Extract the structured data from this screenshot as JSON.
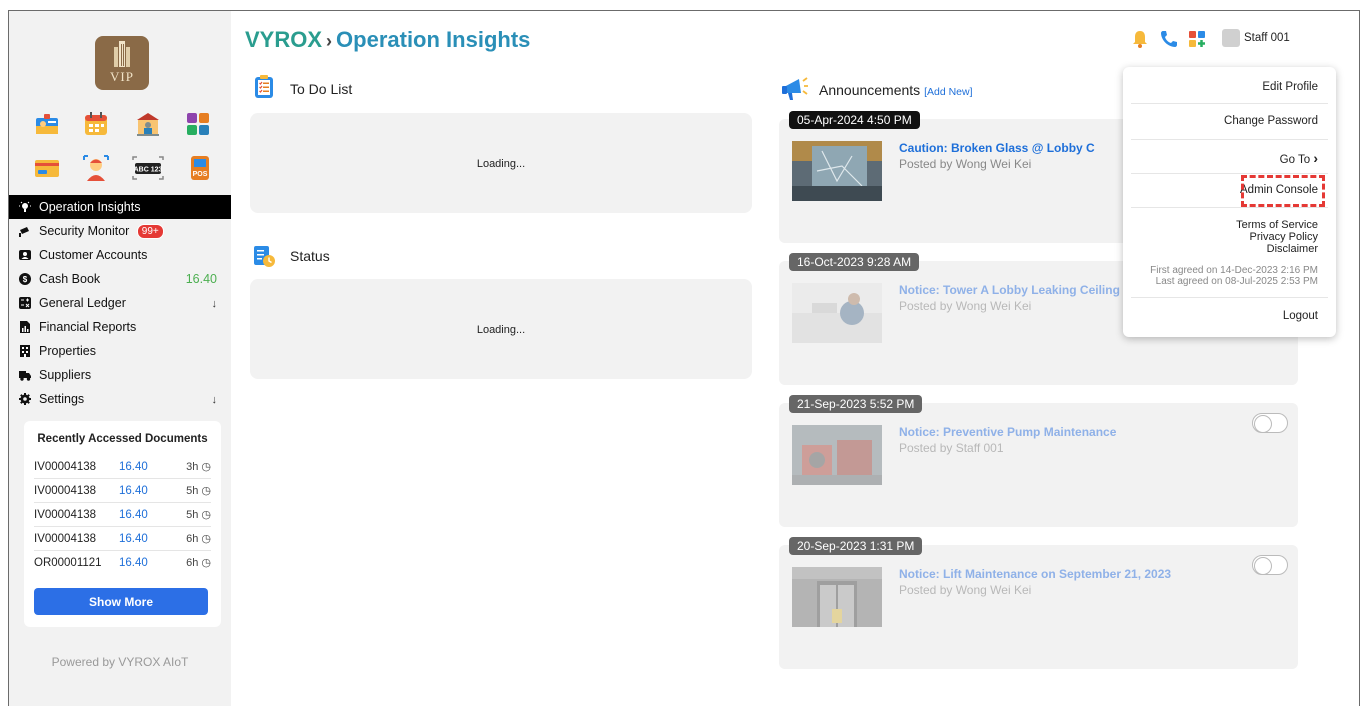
{
  "header": {
    "brand": "VYROX",
    "separator": "›",
    "page_title": "Operation Insights"
  },
  "logo": {
    "text": "VIP"
  },
  "apps": [
    {
      "icon": "id-card-icon"
    },
    {
      "icon": "calendar-icon"
    },
    {
      "icon": "bank-icon"
    },
    {
      "icon": "puzzle-icon"
    },
    {
      "icon": "credit-card-icon"
    },
    {
      "icon": "face-scan-icon"
    },
    {
      "icon": "license-plate-icon",
      "text": "ABC 123"
    },
    {
      "icon": "pos-icon",
      "text": "POS"
    }
  ],
  "sidebar": {
    "items": [
      {
        "label": "Operation Insights",
        "icon": "lightbulb-icon",
        "active": true
      },
      {
        "label": "Security Monitor",
        "icon": "cctv-icon",
        "badge": "99+"
      },
      {
        "label": "Customer Accounts",
        "icon": "address-card-icon"
      },
      {
        "label": "Cash Book",
        "icon": "dollar-circle-icon",
        "value": "16.40"
      },
      {
        "label": "General Ledger",
        "icon": "calculator-icon",
        "arrow": "↓"
      },
      {
        "label": "Financial Reports",
        "icon": "report-icon"
      },
      {
        "label": "Properties",
        "icon": "building-icon"
      },
      {
        "label": "Suppliers",
        "icon": "truck-icon"
      },
      {
        "label": "Settings",
        "icon": "gear-icon",
        "arrow": "↓"
      }
    ]
  },
  "recent": {
    "title": "Recently Accessed Documents",
    "rows": [
      {
        "doc": "IV00004138",
        "amount": "16.40",
        "ago": "3h"
      },
      {
        "doc": "IV00004138",
        "amount": "16.40",
        "ago": "5h"
      },
      {
        "doc": "IV00004138",
        "amount": "16.40",
        "ago": "5h"
      },
      {
        "doc": "IV00004138",
        "amount": "16.40",
        "ago": "6h"
      },
      {
        "doc": "OR00001121",
        "amount": "16.40",
        "ago": "6h"
      }
    ],
    "show_more": "Show More"
  },
  "footer": {
    "powered_by": "Powered by VYROX AIoT"
  },
  "todo": {
    "title": "To Do List",
    "loading": "Loading..."
  },
  "status": {
    "title": "Status",
    "loading": "Loading..."
  },
  "announcements": {
    "title": "Announcements",
    "add_new": "[Add New]",
    "items": [
      {
        "date": "05-Apr-2024 4:50 PM",
        "title": "Caution: Broken Glass @ Lobby C",
        "by": "Posted by Wong Wei Kei"
      },
      {
        "date": "16-Oct-2023 9:28 AM",
        "title": "Notice: Tower A Lobby Leaking Ceiling Re",
        "by": "Posted by Wong Wei Kei"
      },
      {
        "date": "21-Sep-2023 5:52 PM",
        "title": "Notice: Preventive Pump Maintenance",
        "by": "Posted by Staff 001"
      },
      {
        "date": "20-Sep-2023 1:31 PM",
        "title": "Notice: Lift Maintenance on September 21, 2023",
        "by": "Posted by Wong Wei Kei"
      }
    ]
  },
  "user": {
    "name": "Staff 001"
  },
  "dropdown": {
    "edit_profile": "Edit Profile",
    "change_password": "Change Password",
    "go_to": "Go To",
    "go_to_arrow": "›",
    "admin_console": "Admin Console",
    "terms": "Terms of Service",
    "privacy": "Privacy Policy",
    "disclaimer": "Disclaimer",
    "first_agreed": "First agreed on 14-Dec-2023 2:16 PM",
    "last_agreed": "Last agreed on 08-Jul-2025 2:53 PM",
    "logout": "Logout"
  },
  "colors": {
    "brand": "#2a9d8f",
    "title": "#2a8fb7",
    "link": "#1e6fd9",
    "badge": "#e53935",
    "highlight": "#e53935"
  }
}
